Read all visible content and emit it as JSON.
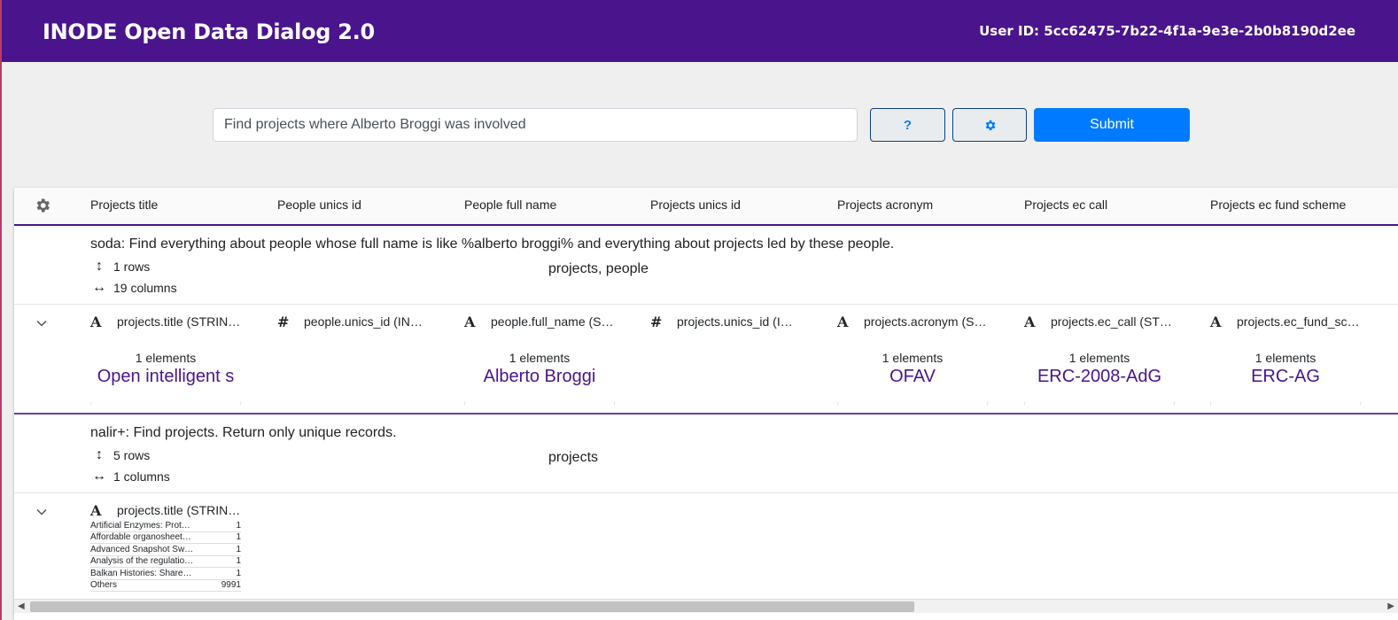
{
  "header": {
    "title": "INODE Open Data Dialog 2.0",
    "user_id": "User ID: 5cc62475-7b22-4f1a-9e3e-2b0b8190d2ee"
  },
  "search": {
    "value": "Find projects where Alberto Broggi was involved",
    "help_label": "?",
    "submit_label": "Submit"
  },
  "table_headers": [
    "Projects title",
    "People unics id",
    "People full name",
    "Projects unics id",
    "Projects acronym",
    "Projects ec call",
    "Projects ec fund scheme"
  ],
  "queries": [
    {
      "description": "soda: Find everything about people whose full name is like %alberto broggi% and everything about projects led by these people.",
      "rows": "1 rows",
      "columns": "19 columns",
      "tables": "projects, people",
      "columns_detail": [
        {
          "type": "A",
          "name": "projects.title (STRIN…",
          "count": "1 elements",
          "value": "Open intelligent s"
        },
        {
          "type": "#",
          "name": "people.unics_id (INT…",
          "count": "",
          "value": ""
        },
        {
          "type": "A",
          "name": "people.full_name (S…",
          "count": "1 elements",
          "value": "Alberto Broggi"
        },
        {
          "type": "#",
          "name": "projects.unics_id (IN…",
          "count": "",
          "value": ""
        },
        {
          "type": "A",
          "name": "projects.acronym (S…",
          "count": "1 elements",
          "value": "OFAV"
        },
        {
          "type": "A",
          "name": "projects.ec_call (ST…",
          "count": "1 elements",
          "value": "ERC-2008-AdG"
        },
        {
          "type": "A",
          "name": "projects.ec_fund_sc…",
          "count": "1 elements",
          "value": "ERC-AG"
        }
      ]
    },
    {
      "description": "nalir+: Find projects. Return only unique records.",
      "rows": "5 rows",
      "columns": "1 columns",
      "tables": "projects",
      "column": {
        "type": "A",
        "name": "projects.title (STRIN…",
        "freq": [
          {
            "label": "Artificial Enzymes: Prot…",
            "count": "1"
          },
          {
            "label": "Affordable organosheet…",
            "count": "1"
          },
          {
            "label": "Advanced Snapshot Sw…",
            "count": "1"
          },
          {
            "label": "Analysis of the regulatio…",
            "count": "1"
          },
          {
            "label": "Balkan Histories: Share…",
            "count": "1"
          },
          {
            "label": "Others",
            "count": "9991"
          }
        ]
      }
    }
  ],
  "colors": {
    "header_bg": "#4a148c",
    "accent": "#007bff",
    "value_text": "#4a148c"
  }
}
